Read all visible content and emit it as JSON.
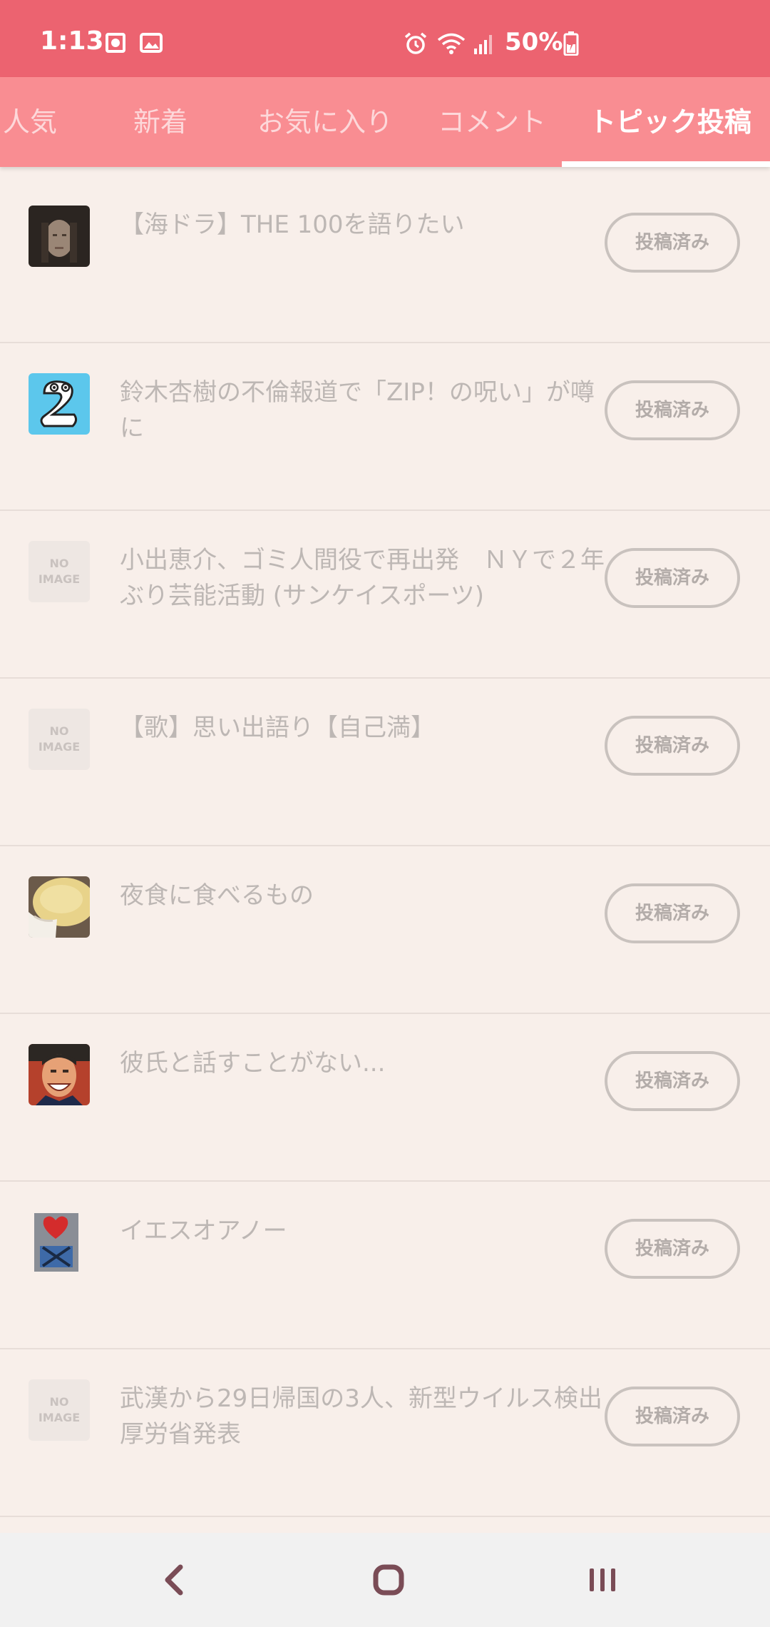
{
  "status_bar": {
    "time": "1:13",
    "battery_text": "50%",
    "icons": [
      "photo-icon",
      "gallery-icon",
      "alarm-icon",
      "wifi-icon",
      "signal-icon",
      "battery-charging-icon"
    ]
  },
  "tabs": [
    {
      "label": "人気"
    },
    {
      "label": "新着"
    },
    {
      "label": "お気に入り"
    },
    {
      "label": "コメント"
    },
    {
      "label": "トピック投稿",
      "active": true
    }
  ],
  "topics": [
    {
      "title": "【海ドラ】THE 100を語りたい",
      "status": "投稿済み",
      "thumb": "portrait-photo"
    },
    {
      "title": "鈴木杏樹の不倫報道で「ZIP！の呪い」が噂に",
      "status": "投稿済み",
      "thumb": "zip-logo"
    },
    {
      "title": "小出恵介、ゴミ人間役で再出発　ＮＹで２年ぶり芸能活動 (サンケイスポーツ)",
      "status": "投稿済み",
      "thumb": "no-image",
      "thumb_text": "NO IMAGE"
    },
    {
      "title": "【歌】思い出語り【自己満】",
      "status": "投稿済み",
      "thumb": "no-image",
      "thumb_text": "NO IMAGE"
    },
    {
      "title": "夜食に食べるもの",
      "status": "投稿済み",
      "thumb": "food-photo"
    },
    {
      "title": "彼氏と話すことがない...",
      "status": "投稿済み",
      "thumb": "smiling-man-photo"
    },
    {
      "title": "イエスオアノー",
      "status": "投稿済み",
      "thumb": "yes-no-image"
    },
    {
      "title": "武漢から29日帰国の3人、新型ウイルス検出 厚労省発表",
      "status": "投稿済み",
      "thumb": "no-image",
      "thumb_text": "NO IMAGE"
    }
  ],
  "colors": {
    "status_bar": "#ec6370",
    "tab_bar": "#f98d92",
    "background": "#f8efea",
    "muted_text": "#bdb7b4"
  },
  "nav_bar": {
    "icons": [
      "back-icon",
      "home-icon",
      "recents-icon"
    ]
  }
}
